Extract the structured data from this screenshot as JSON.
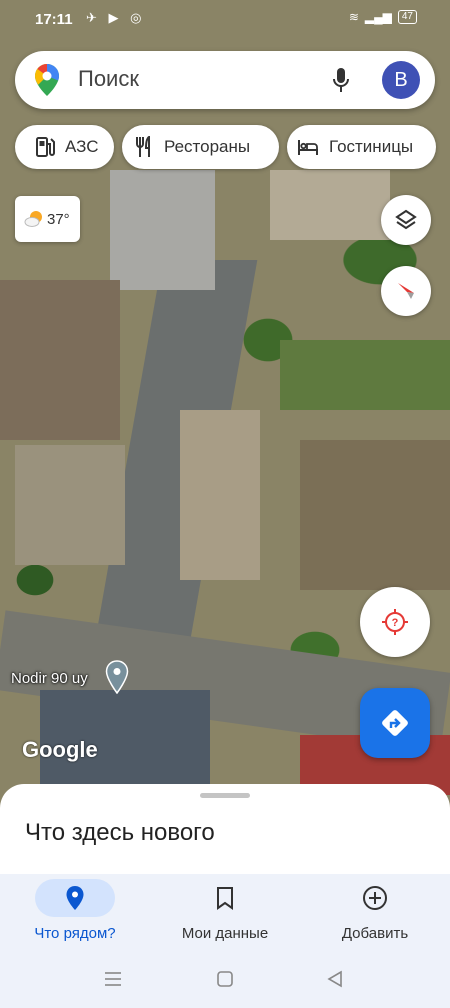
{
  "status_bar": {
    "time": "17:11",
    "battery": "47"
  },
  "search": {
    "placeholder": "Поиск",
    "avatar_letter": "B"
  },
  "chips": [
    {
      "label": "АЗС",
      "icon": "gas-station-icon"
    },
    {
      "label": "Рестораны",
      "icon": "restaurant-icon"
    },
    {
      "label": "Гостиницы",
      "icon": "hotel-icon"
    }
  ],
  "weather": {
    "temperature": "37°",
    "icon": "partly-sunny-icon"
  },
  "map": {
    "place_label": "Nodir 90 uy",
    "attribution": "Google"
  },
  "sheet": {
    "title": "Что здесь нового"
  },
  "bottom_nav": [
    {
      "label": "Что рядом?",
      "icon": "location-pin-icon",
      "active": true
    },
    {
      "label": "Мои данные",
      "icon": "bookmark-icon",
      "active": false
    },
    {
      "label": "Добавить",
      "icon": "add-circle-icon",
      "active": false
    }
  ],
  "colors": {
    "accent": "#1a73e8",
    "active_nav_bg": "#d3e3fd",
    "avatar": "#3f51b5"
  }
}
